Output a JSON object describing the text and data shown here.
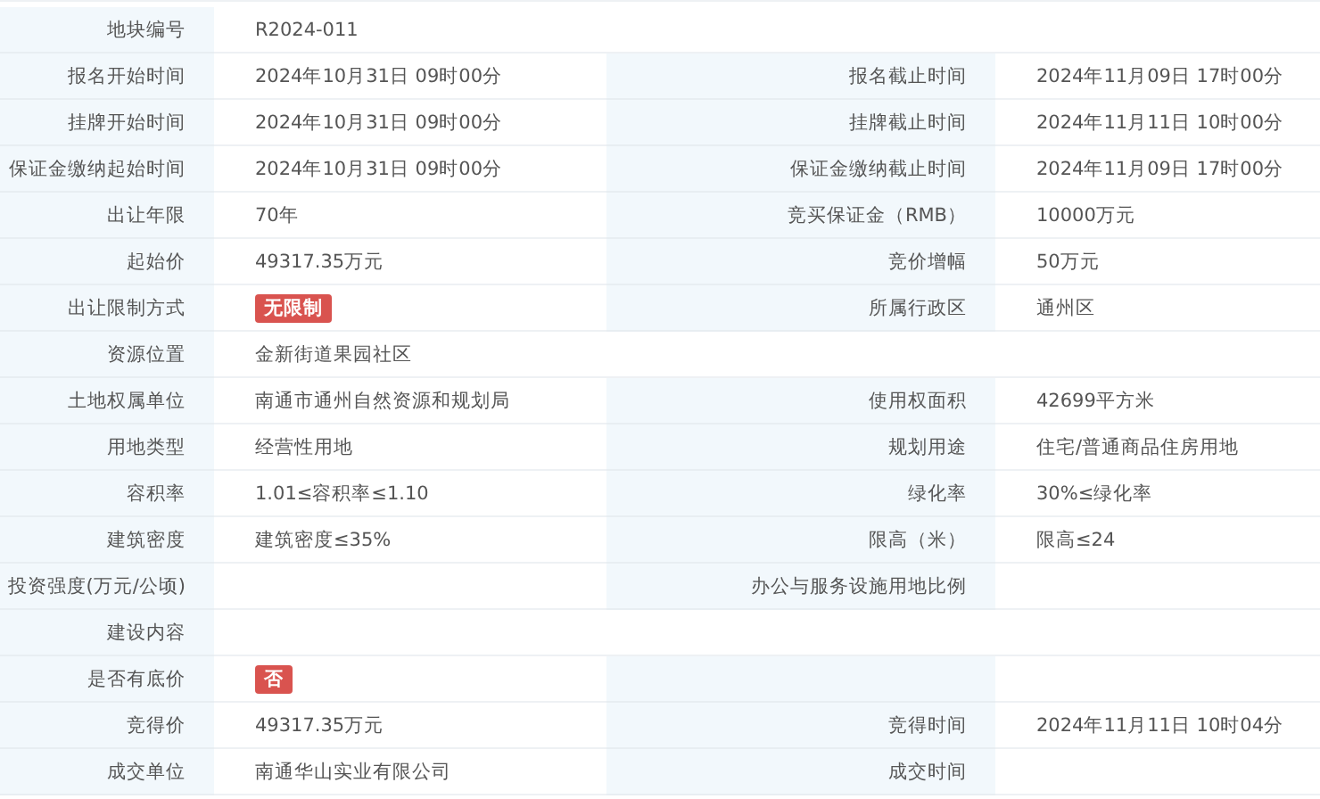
{
  "rows": [
    {
      "kind": "full",
      "pairs": [
        {
          "label": "地块编号",
          "value": "R2024-011"
        }
      ]
    },
    {
      "kind": "split",
      "pairs": [
        {
          "label": "报名开始时间",
          "value": "2024年10月31日 09时00分"
        },
        {
          "label": "报名截止时间",
          "value": "2024年11月09日 17时00分"
        }
      ]
    },
    {
      "kind": "split",
      "pairs": [
        {
          "label": "挂牌开始时间",
          "value": "2024年10月31日 09时00分"
        },
        {
          "label": "挂牌截止时间",
          "value": "2024年11月11日 10时00分"
        }
      ]
    },
    {
      "kind": "split",
      "pairs": [
        {
          "label": "保证金缴纳起始时间",
          "value": "2024年10月31日 09时00分"
        },
        {
          "label": "保证金缴纳截止时间",
          "value": "2024年11月09日 17时00分"
        }
      ]
    },
    {
      "kind": "split",
      "pairs": [
        {
          "label": "出让年限",
          "value": "70年"
        },
        {
          "label": "竞买保证金（RMB）",
          "value": "10000万元"
        }
      ]
    },
    {
      "kind": "split",
      "pairs": [
        {
          "label": "起始价",
          "value": "49317.35万元"
        },
        {
          "label": "竞价增幅",
          "value": "50万元"
        }
      ]
    },
    {
      "kind": "split",
      "pairs": [
        {
          "label": "出让限制方式",
          "tag": "无限制"
        },
        {
          "label": "所属行政区",
          "value": "通州区"
        }
      ]
    },
    {
      "kind": "full",
      "pairs": [
        {
          "label": "资源位置",
          "value": "金新街道果园社区"
        }
      ]
    },
    {
      "kind": "split",
      "pairs": [
        {
          "label": "土地权属单位",
          "value": "南通市通州自然资源和规划局"
        },
        {
          "label": "使用权面积",
          "value": "42699平方米"
        }
      ]
    },
    {
      "kind": "split",
      "pairs": [
        {
          "label": "用地类型",
          "value": "经营性用地"
        },
        {
          "label": "规划用途",
          "value": "住宅/普通商品住房用地"
        }
      ]
    },
    {
      "kind": "split",
      "pairs": [
        {
          "label": "容积率",
          "value": "1.01≤容积率≤1.10"
        },
        {
          "label": "绿化率",
          "value": "30%≤绿化率"
        }
      ]
    },
    {
      "kind": "split",
      "pairs": [
        {
          "label": "建筑密度",
          "value": "建筑密度≤35%"
        },
        {
          "label": "限高（米）",
          "value": "限高≤24"
        }
      ]
    },
    {
      "kind": "split",
      "pairs": [
        {
          "label": "投资强度(万元/公顷)"
        },
        {
          "label": "办公与服务设施用地比例"
        }
      ]
    },
    {
      "kind": "full",
      "pairs": [
        {
          "label": "建设内容"
        }
      ]
    },
    {
      "kind": "split",
      "pairs": [
        {
          "label": "是否有底价",
          "tag": "否"
        }
      ]
    },
    {
      "kind": "split",
      "pairs": [
        {
          "label": "竞得价",
          "value": "49317.35万元"
        },
        {
          "label": "竞得时间",
          "value": "2024年11月11日 10时04分"
        }
      ]
    },
    {
      "kind": "split",
      "pairs": [
        {
          "label": "成交单位",
          "value": "南通华山实业有限公司"
        },
        {
          "label": "成交时间"
        }
      ]
    }
  ]
}
